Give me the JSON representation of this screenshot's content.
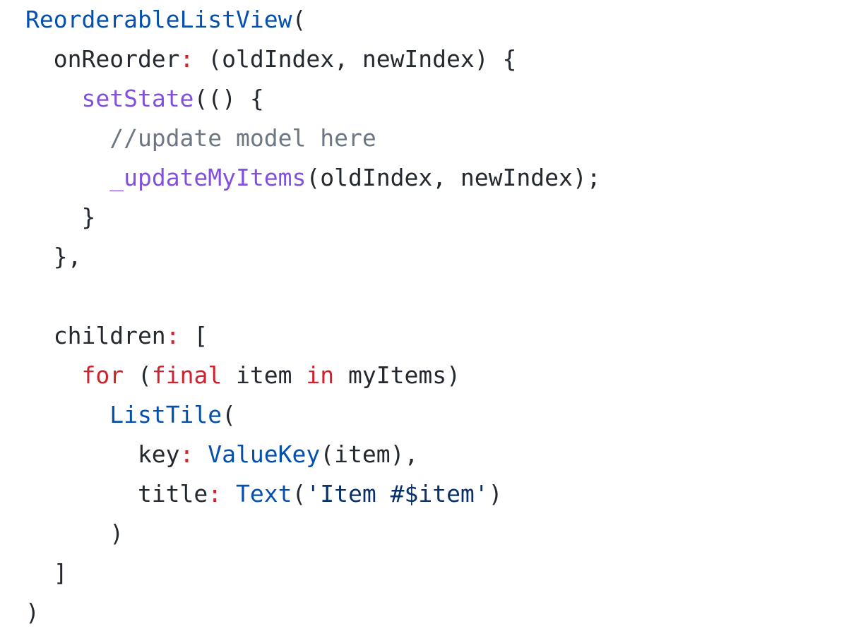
{
  "colors": {
    "background": "#ffffff",
    "plain": "#24292f",
    "keyword": "#cf222e",
    "function": "#8250df",
    "type": "#0550ae",
    "comment": "#6e7781",
    "string": "#0a3069"
  },
  "code": {
    "language": "dart",
    "lines": [
      [
        {
          "t": "ty",
          "v": "ReorderableListView"
        },
        {
          "t": "pl",
          "v": "("
        }
      ],
      [
        {
          "t": "pl",
          "v": "  onReorder"
        },
        {
          "t": "kw",
          "v": ":"
        },
        {
          "t": "pl",
          "v": " (oldIndex, newIndex) {"
        }
      ],
      [
        {
          "t": "pl",
          "v": "    "
        },
        {
          "t": "fn",
          "v": "setState"
        },
        {
          "t": "pl",
          "v": "(() {"
        }
      ],
      [
        {
          "t": "cm",
          "v": "      //update model here"
        }
      ],
      [
        {
          "t": "pl",
          "v": "      "
        },
        {
          "t": "fn",
          "v": "_updateMyItems"
        },
        {
          "t": "pl",
          "v": "(oldIndex, newIndex);"
        }
      ],
      [
        {
          "t": "pl",
          "v": "    }"
        }
      ],
      [
        {
          "t": "pl",
          "v": "  },"
        }
      ],
      [],
      [
        {
          "t": "pl",
          "v": "  children"
        },
        {
          "t": "kw",
          "v": ":"
        },
        {
          "t": "pl",
          "v": " ["
        }
      ],
      [
        {
          "t": "pl",
          "v": "    "
        },
        {
          "t": "kw",
          "v": "for"
        },
        {
          "t": "pl",
          "v": " ("
        },
        {
          "t": "kw",
          "v": "final"
        },
        {
          "t": "pl",
          "v": " item "
        },
        {
          "t": "kw",
          "v": "in"
        },
        {
          "t": "pl",
          "v": " myItems)"
        }
      ],
      [
        {
          "t": "pl",
          "v": "      "
        },
        {
          "t": "ty",
          "v": "ListTile"
        },
        {
          "t": "pl",
          "v": "("
        }
      ],
      [
        {
          "t": "pl",
          "v": "        key"
        },
        {
          "t": "kw",
          "v": ":"
        },
        {
          "t": "pl",
          "v": " "
        },
        {
          "t": "ty",
          "v": "ValueKey"
        },
        {
          "t": "pl",
          "v": "(item),"
        }
      ],
      [
        {
          "t": "pl",
          "v": "        title"
        },
        {
          "t": "kw",
          "v": ":"
        },
        {
          "t": "pl",
          "v": " "
        },
        {
          "t": "ty",
          "v": "Text"
        },
        {
          "t": "pl",
          "v": "("
        },
        {
          "t": "st",
          "v": "'Item #$item'"
        },
        {
          "t": "pl",
          "v": ")"
        }
      ],
      [
        {
          "t": "pl",
          "v": "      )"
        }
      ],
      [
        {
          "t": "pl",
          "v": "  ]"
        }
      ],
      [
        {
          "t": "pl",
          "v": ")"
        }
      ]
    ]
  }
}
